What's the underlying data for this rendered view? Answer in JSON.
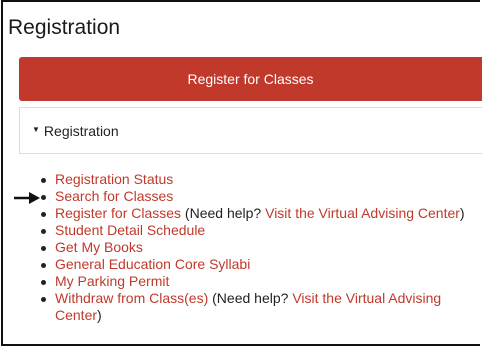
{
  "header": {
    "title": "Registration"
  },
  "register_button": {
    "label": "Register for Classes"
  },
  "panel": {
    "label": "Registration",
    "caret_icon": "caret-down-icon"
  },
  "links": [
    {
      "text": "Registration Status"
    },
    {
      "text": "Search for Classes",
      "pointer_icon": "arrow-right-icon"
    },
    {
      "text": "Register for Classes",
      "help_prefix": " (Need help? ",
      "help_link": "Visit the Virtual Advising Center",
      "help_suffix": ")"
    },
    {
      "text": "Student Detail Schedule"
    },
    {
      "text": "Get My Books"
    },
    {
      "text": "General Education Core Syllabi"
    },
    {
      "text": "My Parking Permit"
    },
    {
      "text": "Withdraw from Class(es)",
      "help_prefix": " (Need help? ",
      "help_link": "Visit the Virtual Advising Center",
      "help_suffix": ")"
    }
  ],
  "colors": {
    "accent": "#c0392b",
    "text": "#222222"
  }
}
